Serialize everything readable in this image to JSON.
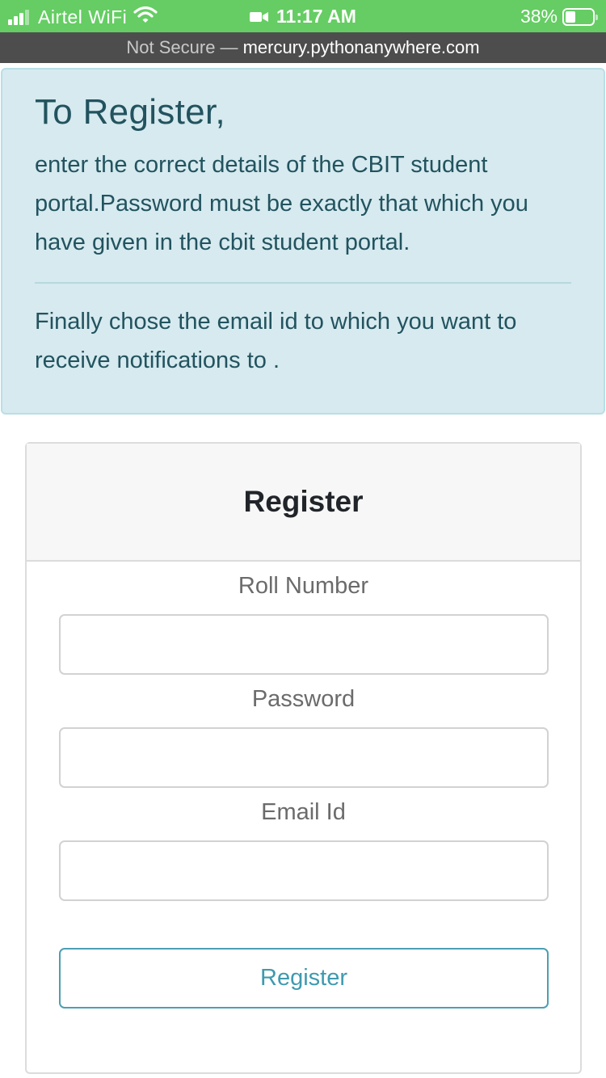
{
  "status_bar": {
    "carrier": "Airtel WiFi",
    "time": "11:17 AM",
    "battery": "38%",
    "battery_level": 0.38
  },
  "url_bar": {
    "security": "Not Secure —",
    "domain": "mercury.pythonanywhere.com"
  },
  "alert": {
    "heading": "To Register,",
    "paragraph1": "enter the correct details of the CBIT student portal.Password must be exactly that which you have given in the cbit student portal.",
    "paragraph2": "Finally chose the email id to which you want to receive notifications to ."
  },
  "form": {
    "title": "Register",
    "fields": [
      {
        "label": "Roll Number",
        "value": "",
        "placeholder": ""
      },
      {
        "label": "Password",
        "value": "",
        "placeholder": ""
      },
      {
        "label": "Email Id",
        "value": "",
        "placeholder": ""
      }
    ],
    "submit_label": "Register"
  },
  "colors": {
    "status_bar": "#65cd63",
    "url_bar": "#4d4d4d",
    "alert_bg": "#d6eaef",
    "alert_text": "#22535f",
    "button_border": "#4d9fb3"
  },
  "icons": {
    "signal": "cellular-signal-icon",
    "wifi": "wifi-icon",
    "video": "video-camera-icon",
    "battery": "battery-icon"
  }
}
